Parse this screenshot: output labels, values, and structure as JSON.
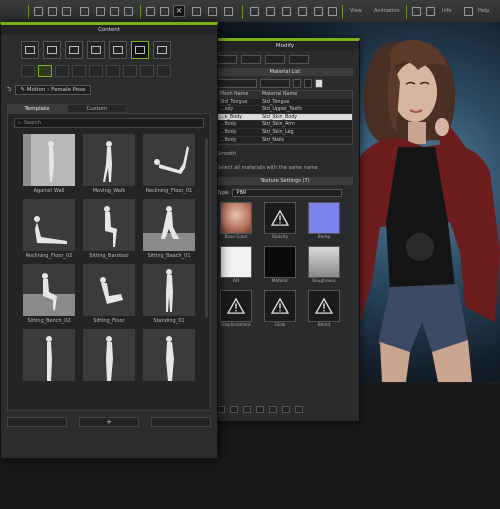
{
  "colors": {
    "accent": "#7ab317",
    "panel_bg": "#2b2c2e",
    "viewport_bg": "#2b4a62"
  },
  "toolbar": {
    "view_label": "View",
    "animation_label": "Animation",
    "menu_a": "Info",
    "menu_b": "Help"
  },
  "content_panel": {
    "title": "Content",
    "breadcrumb": [
      "Motion",
      "Female Pose"
    ],
    "tabs": [
      "Template",
      "Custom"
    ],
    "search_placeholder": "Search",
    "footer": {
      "add_label": "+"
    },
    "items": [
      {
        "label": "Against Wall"
      },
      {
        "label": "Moving_Walk"
      },
      {
        "label": "Reclining_Floor_01"
      },
      {
        "label": "Reclining_Floor_02"
      },
      {
        "label": "Sitting_Barstool"
      },
      {
        "label": "Sitting_Beach_01"
      },
      {
        "label": "Sitting_Bench_02"
      },
      {
        "label": "Sitting_Floor"
      },
      {
        "label": "Standing_01"
      },
      {
        "label": ""
      },
      {
        "label": ""
      },
      {
        "label": ""
      }
    ]
  },
  "modify_panel": {
    "title": "Modify",
    "material_list_label": "Material List",
    "columns": [
      "Mesh Name",
      "Material Name"
    ],
    "rows": [
      {
        "mesh": "Std_Tongue",
        "material": "Std_Tongue"
      },
      {
        "mesh": "...ody",
        "material": "Std_Upper_Teeth"
      },
      {
        "mesh": "...e_Body",
        "material": "Std_Skin_Body"
      },
      {
        "mesh": "...Body",
        "material": "Std_Skin_Arm"
      },
      {
        "mesh": "...Body",
        "material": "Std_Skin_Leg"
      },
      {
        "mesh": "...Body",
        "material": "Std_Nails"
      }
    ],
    "selected_row": 2,
    "smooth_label": "Smooth",
    "select_all_text": "Select all materials with the same name",
    "texture_settings_label": "Texture Settings (7)",
    "type_label": "Type",
    "type_value": "PBR",
    "textures": [
      {
        "label": "Base Color",
        "kind": "skin"
      },
      {
        "label": "Opacity",
        "kind": "warning"
      },
      {
        "label": "Bump",
        "kind": "normal"
      },
      {
        "label": "AO",
        "kind": "white"
      },
      {
        "label": "Metallic",
        "kind": "black"
      },
      {
        "label": "Roughness",
        "kind": "rough"
      },
      {
        "label": "Displacement",
        "kind": "warning"
      },
      {
        "label": "Glow",
        "kind": "warning"
      },
      {
        "label": "Blend",
        "kind": "warning"
      }
    ]
  }
}
